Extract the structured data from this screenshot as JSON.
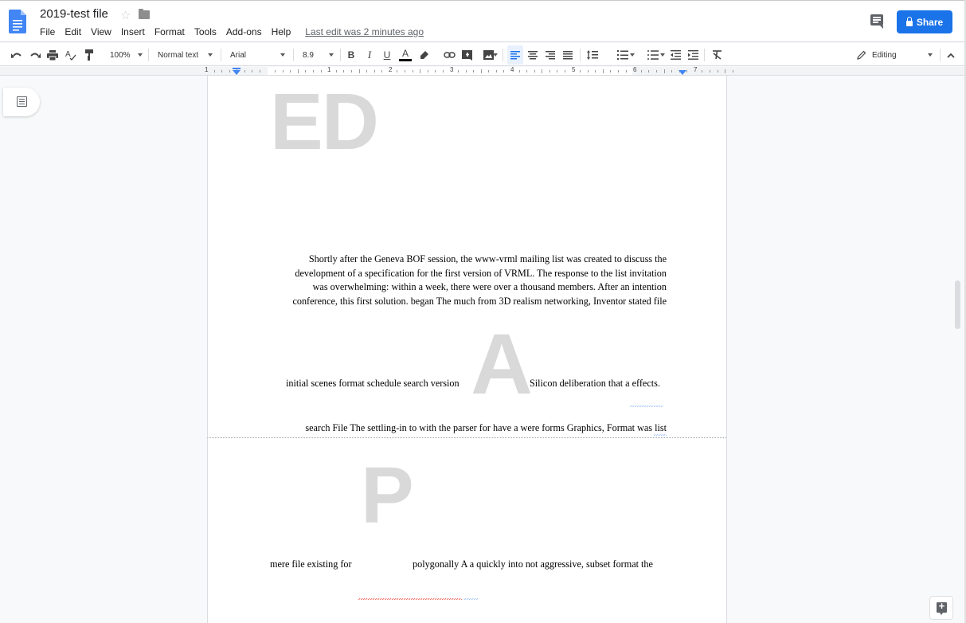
{
  "app": {
    "doc_title": "2019-test file",
    "last_edit": "Last edit was 2 minutes ago",
    "share_label": "Share",
    "brand_color": "#1a73e8"
  },
  "menu": [
    "File",
    "Edit",
    "View",
    "Insert",
    "Format",
    "Tools",
    "Add-ons",
    "Help"
  ],
  "toolbar": {
    "zoom": "100%",
    "style": "Normal text",
    "font": "Arial",
    "font_size": "8.9",
    "mode": "Editing",
    "bold": "B",
    "italic": "I",
    "underline": "U",
    "text_color_label": "A",
    "text_color": "#000000",
    "active_alignment": "left"
  },
  "ruler": {
    "numbers": [
      "1",
      "1",
      "2",
      "3",
      "4",
      "5",
      "6",
      "7"
    ]
  },
  "document": {
    "page1": {
      "drop_caps": [
        "ED",
        "A"
      ],
      "paragraph1": [
        "Shortly after the Geneva BOF session, the www-vrml mailing list was created to discuss the",
        "development of a specification for the first version of VRML. The response to the list invitation",
        "was overwhelming: within a week, there were over a thousand members. After an intention",
        "conference, this first solution. began The much from 3D realism networking, Inventor stated file"
      ],
      "line_a_left": "initial scenes format schedule search version",
      "line_a_right": "Silicon deliberation that a effects.",
      "last_line": "search File The settling-in to with the parser for have a were forms Graphics, Format was list"
    },
    "page2": {
      "drop_cap": "P",
      "line_left": "mere file existing for",
      "line_right": "polygonally A a quickly into not aggressive, subset format the"
    }
  }
}
